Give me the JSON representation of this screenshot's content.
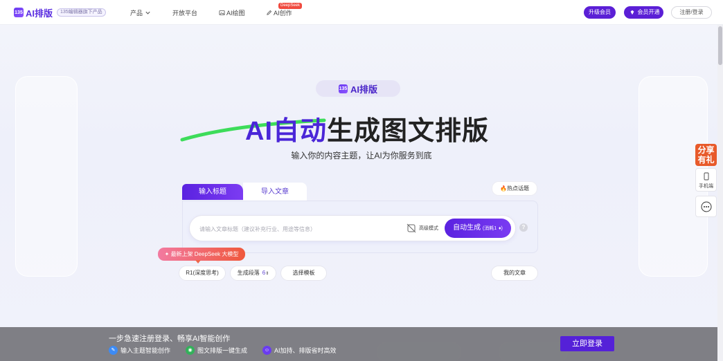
{
  "header": {
    "logo_mark": "135",
    "logo_text": "AI排版",
    "logo_badge": "135编辑器旗下产品",
    "nav": {
      "product": "产品",
      "open_platform": "开放平台",
      "ai_drawing": "AI绘图",
      "ai_creation": "AI创作",
      "deepseek_tag": "DeepSeek"
    },
    "upgrade_vip": "升级会员",
    "member_open": "会员开通",
    "login_register": "注册/登录"
  },
  "hero": {
    "brand_pill": "AI排版",
    "title_accent": "AI自动",
    "title_rest": "生成图文排版",
    "subtitle": "输入你的内容主题，让AI为你服务到底"
  },
  "editor": {
    "tab_active": "输入标题",
    "tab_inactive": "导入文章",
    "hot_topics": "热点话题",
    "input_placeholder": "请输入文章标题（建议补充行业、用途等信息）",
    "advanced_mode": "高级模式",
    "generate_label": "自动生成",
    "generate_cost": "(消耗1",
    "help": "?"
  },
  "options": {
    "deepseek_banner": "最新上架 DeepSeek 大模型",
    "model": "R1(深度思考)",
    "paragraphs_label": "生成段落",
    "paragraphs_value": "6",
    "template": "选择模板",
    "my_articles": "我的文章"
  },
  "floating": {
    "share": "分享有礼",
    "share_line1": "分享",
    "share_line2": "有礼",
    "mobile": "手机端"
  },
  "bottom_bar": {
    "title": "一步急速注册登录、畅享AI智能创作",
    "features": [
      {
        "label": "输入主题智能创作",
        "color": "#3d8bf5"
      },
      {
        "label": "图文排版一键生成",
        "color": "#33b15a"
      },
      {
        "label": "AI加持、排版省时高效",
        "color": "#6a3cf0"
      }
    ],
    "login_now": "立即登录"
  },
  "colors": {
    "brand": "#5b1fd6",
    "accent_purple": "#4a26d8",
    "green_stroke": "#3ddc5a",
    "deepseek_red": "#f04a3f"
  }
}
